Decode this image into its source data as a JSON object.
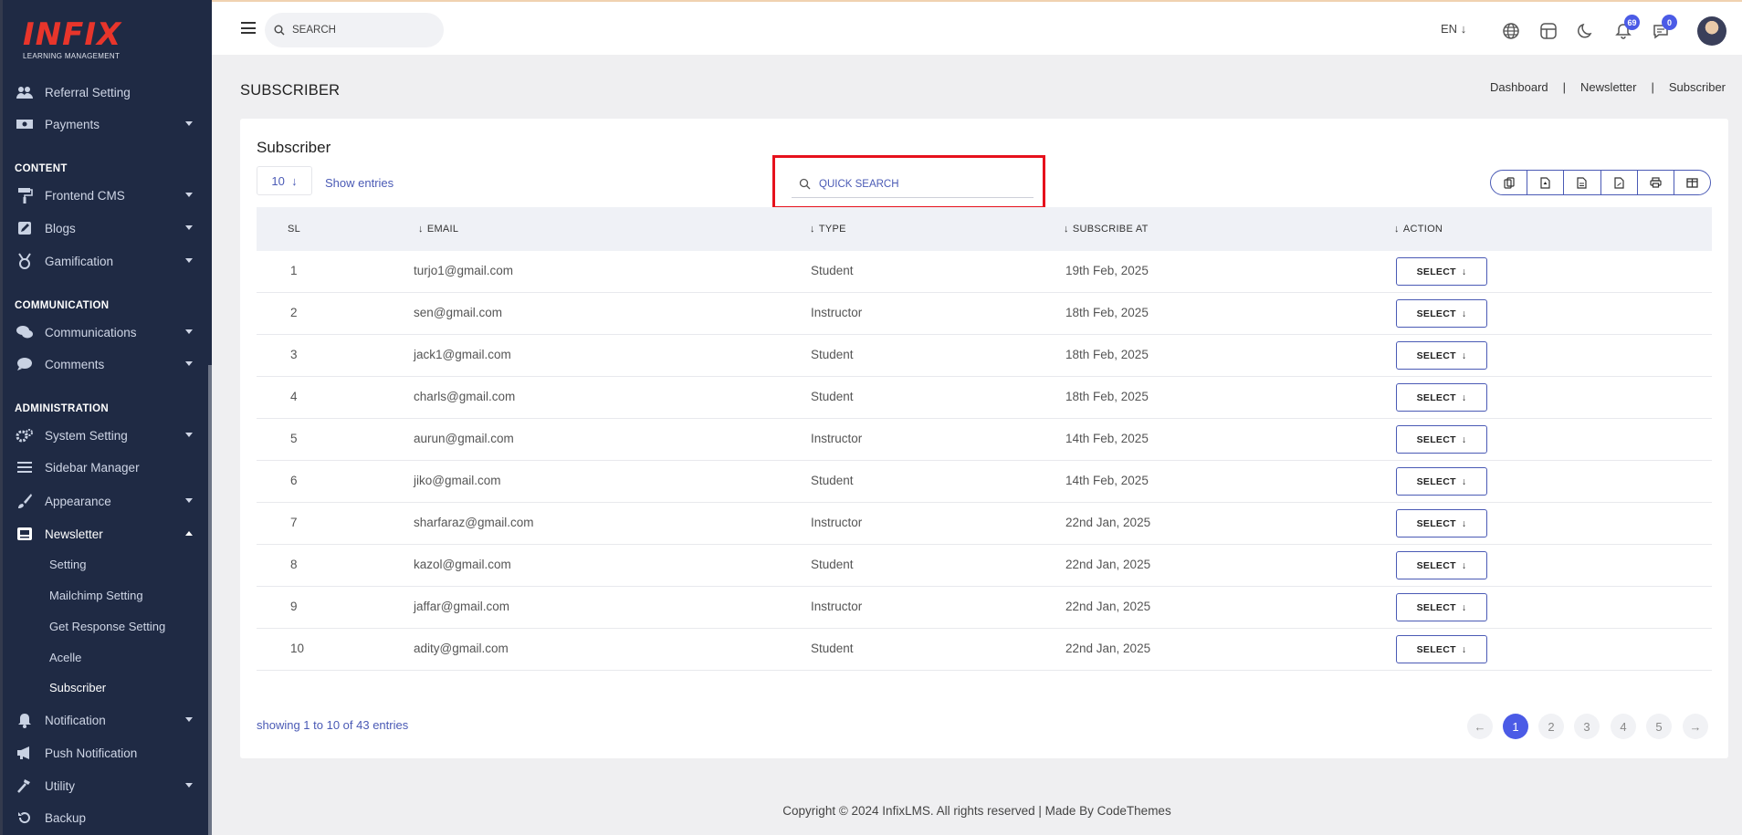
{
  "brand": {
    "logo_text": "INFIX",
    "logo_sub": "LEARNING MANAGEMENT"
  },
  "sidebar": {
    "items": [
      {
        "label": "Referral Setting"
      },
      {
        "label": "Payments"
      },
      {
        "label": "Frontend CMS"
      },
      {
        "label": "Blogs"
      },
      {
        "label": "Gamification"
      },
      {
        "label": "Communications"
      },
      {
        "label": "Comments"
      },
      {
        "label": "System Setting"
      },
      {
        "label": "Sidebar Manager"
      },
      {
        "label": "Appearance"
      },
      {
        "label": "Newsletter"
      },
      {
        "label": "Notification"
      },
      {
        "label": "Push Notification"
      },
      {
        "label": "Utility"
      },
      {
        "label": "Backup"
      }
    ],
    "sections": [
      "CONTENT",
      "COMMUNICATION",
      "ADMINISTRATION"
    ],
    "newsletter_sub": [
      "Setting",
      "Mailchimp Setting",
      "Get Response Setting",
      "Acelle",
      "Subscriber"
    ]
  },
  "header": {
    "search_placeholder": "SEARCH",
    "lang": "EN",
    "notifications_count": "69",
    "messages_count": "0"
  },
  "page": {
    "title": "SUBSCRIBER",
    "breadcrumb": [
      "Dashboard",
      "Newsletter",
      "Subscriber"
    ]
  },
  "card": {
    "title": "Subscriber",
    "entries_value": "10",
    "show_entries": "Show entries",
    "quick_search_placeholder": "QUICK SEARCH",
    "export_icons": [
      "copy-icon",
      "csv-icon",
      "excel-icon",
      "pdf-icon",
      "print-icon",
      "columns-icon"
    ]
  },
  "table": {
    "headers": [
      "SL",
      "EMAIL",
      "TYPE",
      "SUBSCRIBE AT",
      "ACTION"
    ],
    "rows": [
      {
        "sl": "1",
        "email": "turjo1@gmail.com",
        "type": "Student",
        "date": "19th Feb, 2025",
        "action": "SELECT"
      },
      {
        "sl": "2",
        "email": "sen@gmail.com",
        "type": "Instructor",
        "date": "18th Feb, 2025",
        "action": "SELECT"
      },
      {
        "sl": "3",
        "email": "jack1@gmail.com",
        "type": "Student",
        "date": "18th Feb, 2025",
        "action": "SELECT"
      },
      {
        "sl": "4",
        "email": "charls@gmail.com",
        "type": "Student",
        "date": "18th Feb, 2025",
        "action": "SELECT"
      },
      {
        "sl": "5",
        "email": "aurun@gmail.com",
        "type": "Instructor",
        "date": "14th Feb, 2025",
        "action": "SELECT"
      },
      {
        "sl": "6",
        "email": "jiko@gmail.com",
        "type": "Student",
        "date": "14th Feb, 2025",
        "action": "SELECT"
      },
      {
        "sl": "7",
        "email": "sharfaraz@gmail.com",
        "type": "Instructor",
        "date": "22nd Jan, 2025",
        "action": "SELECT"
      },
      {
        "sl": "8",
        "email": "kazol@gmail.com",
        "type": "Student",
        "date": "22nd Jan, 2025",
        "action": "SELECT"
      },
      {
        "sl": "9",
        "email": "jaffar@gmail.com",
        "type": "Instructor",
        "date": "22nd Jan, 2025",
        "action": "SELECT"
      },
      {
        "sl": "10",
        "email": "adity@gmail.com",
        "type": "Student",
        "date": "22nd Jan, 2025",
        "action": "SELECT"
      }
    ]
  },
  "pagination": {
    "summary": "showing 1 to 10 of 43 entries",
    "pages": [
      "1",
      "2",
      "3",
      "4",
      "5"
    ],
    "active": "1"
  },
  "footer": {
    "text": "Copyright © 2024 InfixLMS. All rights reserved | Made By CodeThemes"
  },
  "colors": {
    "accent": "#4b5be6",
    "sidebar": "#1f2a44",
    "highlight": "#e6111c"
  }
}
